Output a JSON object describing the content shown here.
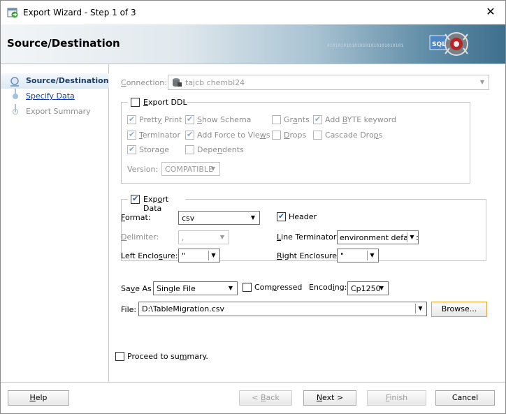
{
  "window": {
    "title": "Export Wizard - Step 1 of 3",
    "close_glyph": "✕"
  },
  "banner": {
    "heading": "Source/Destination",
    "binary_text": "0101010101010101010101010101"
  },
  "nav": {
    "items": [
      {
        "label": "Source/Destination",
        "state": "active"
      },
      {
        "label": "Specify Data",
        "state": "link"
      },
      {
        "label": "Export Summary",
        "state": "disabled"
      }
    ]
  },
  "connection": {
    "label": "Connection:",
    "value": "tajcb chembl24"
  },
  "export_ddl": {
    "label": "Export DDL",
    "checked": false,
    "options": [
      {
        "label": "Pretty Print",
        "checked": true
      },
      {
        "label": "Show Schema",
        "checked": true
      },
      {
        "label": "Grants",
        "checked": false
      },
      {
        "label": "Add BYTE keyword",
        "checked": true
      },
      {
        "label": "Terminator",
        "checked": true
      },
      {
        "label": "Add Force to Views",
        "checked": true
      },
      {
        "label": "Drops",
        "checked": false
      },
      {
        "label": "Cascade Drops",
        "checked": false
      },
      {
        "label": "Storage",
        "checked": true
      },
      {
        "label": "Dependents",
        "checked": false
      }
    ],
    "version_label": "Version:",
    "version_value": "COMPATIBLE"
  },
  "export_data": {
    "label": "Export Data",
    "checked": true,
    "format_label": "Format:",
    "format_value": "csv",
    "header_label": "Header",
    "header_checked": true,
    "delimiter_label": "Delimiter:",
    "delimiter_value": ",",
    "line_terminator_label": "Line Terminator:",
    "line_terminator_value": "environment default",
    "left_enclosure_label": "Left Enclosure:",
    "left_enclosure_value": "\"",
    "right_enclosure_label": "Right Enclosure:",
    "right_enclosure_value": "\""
  },
  "output": {
    "save_as_label": "Save As",
    "save_as_value": "Single File",
    "compressed_label": "Compressed",
    "compressed_checked": false,
    "encoding_label": "Encoding:",
    "encoding_value": "Cp1250",
    "file_label": "File:",
    "file_value": "D:\\TableMigration.csv",
    "browse_label": "Browse..."
  },
  "proceed": {
    "label": "Proceed to summary.",
    "checked": false
  },
  "footer": {
    "help": "Help",
    "back": "< Back",
    "next": "Next >",
    "finish": "Finish",
    "cancel": "Cancel"
  }
}
